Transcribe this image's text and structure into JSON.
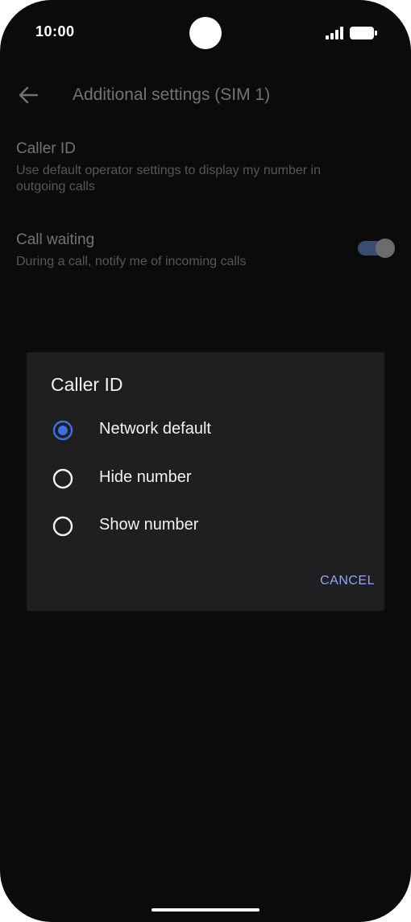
{
  "status_bar": {
    "time": "10:00"
  },
  "app_bar": {
    "title": "Additional settings (SIM 1)",
    "back_icon": "arrow-left-icon"
  },
  "settings": {
    "caller_id": {
      "title": "Caller ID",
      "summary": "Use default operator settings to display my number in outgoing calls"
    },
    "call_waiting": {
      "title": "Call waiting",
      "summary": "During a call, notify me of incoming calls",
      "enabled": true
    }
  },
  "dialog": {
    "title": "Caller ID",
    "options": [
      {
        "label": "Network default",
        "selected": true
      },
      {
        "label": "Hide number",
        "selected": false
      },
      {
        "label": "Show number",
        "selected": false
      }
    ],
    "cancel_label": "CANCEL"
  },
  "colors": {
    "accent": "#3d6fe0",
    "cancel_text": "#8fa5ff",
    "dialog_bg": "#1f1f1f",
    "screen_bg": "#0b0b0b"
  }
}
